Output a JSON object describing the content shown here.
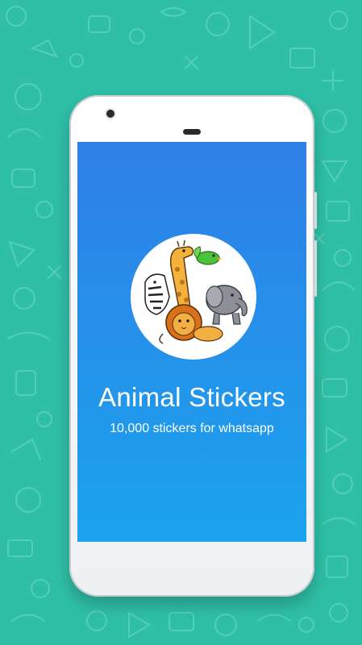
{
  "background": {
    "color": "#2fbfa7",
    "pattern": "doodle-icons"
  },
  "splash": {
    "app_title": "Animal Stickers",
    "subtitle": "10,000 stickers for whatsapp",
    "logo_icon": "animal-group-icon",
    "gradient_top": "#2f7fe6",
    "gradient_bottom": "#1ba3ee"
  }
}
